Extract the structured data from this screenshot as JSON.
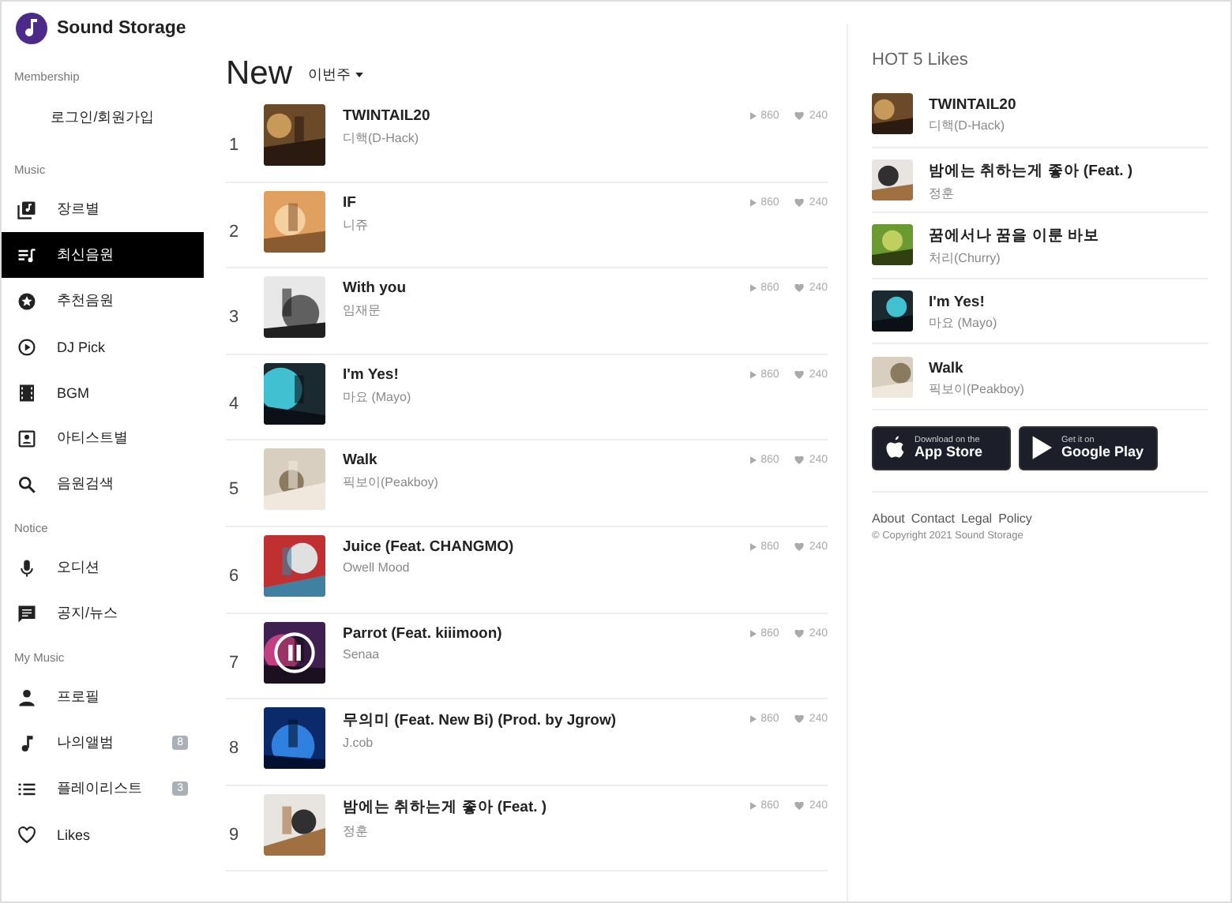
{
  "brand": {
    "name": "Sound Storage"
  },
  "sidebar": {
    "sections": [
      {
        "label": "Membership",
        "items": [
          {
            "kind": "login",
            "label": "로그인/회원가입",
            "selected": false
          }
        ]
      },
      {
        "label": "Music",
        "items": [
          {
            "kind": "genre",
            "label": "장르별",
            "selected": false
          },
          {
            "kind": "new",
            "label": "최신음원",
            "selected": true
          },
          {
            "kind": "star",
            "label": "추천음원",
            "selected": false
          },
          {
            "kind": "play",
            "label": "DJ Pick",
            "selected": false
          },
          {
            "kind": "film",
            "label": "BGM",
            "selected": false
          },
          {
            "kind": "artist",
            "label": "아티스트별",
            "selected": false
          },
          {
            "kind": "search",
            "label": "음원검색",
            "selected": false
          }
        ]
      },
      {
        "label": "Notice",
        "items": [
          {
            "kind": "mic",
            "label": "오디션",
            "selected": false
          },
          {
            "kind": "news",
            "label": "공지/뉴스",
            "selected": false
          }
        ]
      },
      {
        "label": "My Music",
        "items": [
          {
            "kind": "person",
            "label": "프로필",
            "selected": false
          },
          {
            "kind": "note",
            "label": "나의앨범",
            "badge": "8",
            "selected": false
          },
          {
            "kind": "list",
            "label": "플레이리스트",
            "badge": "3",
            "selected": false
          },
          {
            "kind": "heart",
            "label": "Likes",
            "selected": false
          }
        ]
      }
    ]
  },
  "main": {
    "title": "New",
    "period": "이번주",
    "tracks": [
      {
        "rank": "1",
        "title": "TWINTAIL20",
        "artist": "디핵(D-Hack)",
        "plays": "860",
        "likes": "240",
        "playing": false
      },
      {
        "rank": "2",
        "title": "IF",
        "artist": "니쥬",
        "plays": "860",
        "likes": "240",
        "playing": false
      },
      {
        "rank": "3",
        "title": "With you",
        "artist": "임재문",
        "plays": "860",
        "likes": "240",
        "playing": false
      },
      {
        "rank": "4",
        "title": "I'm Yes!",
        "artist": "마요 (Mayo)",
        "plays": "860",
        "likes": "240",
        "playing": false
      },
      {
        "rank": "5",
        "title": "Walk",
        "artist": "픽보이(Peakboy)",
        "plays": "860",
        "likes": "240",
        "playing": false
      },
      {
        "rank": "6",
        "title": "Juice (Feat. CHANGMO)",
        "artist": "Owell Mood",
        "plays": "860",
        "likes": "240",
        "playing": false
      },
      {
        "rank": "7",
        "title": "Parrot (Feat. kiiimoon)",
        "artist": "Senaa",
        "plays": "860",
        "likes": "240",
        "playing": true
      },
      {
        "rank": "8",
        "title": "무의미 (Feat. New Bi) (Prod. by Jgrow)",
        "artist": "J.cob",
        "plays": "860",
        "likes": "240",
        "playing": false
      },
      {
        "rank": "9",
        "title": "밤에는 취하는게 좋아 (Feat. )",
        "artist": "정훈",
        "plays": "860",
        "likes": "240",
        "playing": false
      }
    ]
  },
  "hot": {
    "title": "HOT 5 Likes",
    "tracks": [
      {
        "title": "TWINTAIL20",
        "artist": "디핵(D-Hack)"
      },
      {
        "title": "밤에는 취하는게 좋아 (Feat. )",
        "artist": "정훈"
      },
      {
        "title": "꿈에서나 꿈을 이룬 바보",
        "artist": "처리(Churry)"
      },
      {
        "title": "I'm Yes!",
        "artist": "마요 (Mayo)"
      },
      {
        "title": "Walk",
        "artist": "픽보이(Peakboy)"
      }
    ]
  },
  "stores": [
    {
      "kind": "apple",
      "small": "Download on the",
      "big": "App Store"
    },
    {
      "kind": "google",
      "small": "Get it on",
      "big": "Google Play"
    }
  ],
  "footer": {
    "links": [
      "About",
      "Contact",
      "Legal",
      "Policy"
    ],
    "copyright": "© Copyright 2021 Sound Storage"
  }
}
